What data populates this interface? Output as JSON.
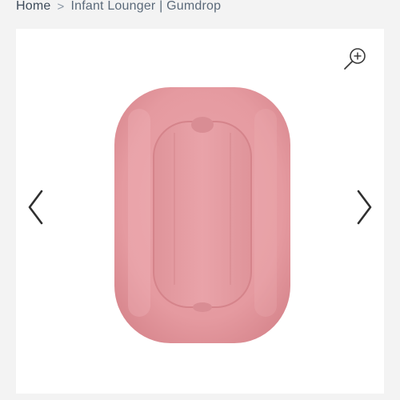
{
  "breadcrumb": {
    "home_label": "Home",
    "separator": ">",
    "current_label": "Infant Lounger | Gumdrop"
  },
  "gallery": {
    "zoom_icon": "zoom-in-icon",
    "prev_icon": "chevron-left-icon",
    "next_icon": "chevron-right-icon",
    "product_color": "#e7a0a6"
  }
}
